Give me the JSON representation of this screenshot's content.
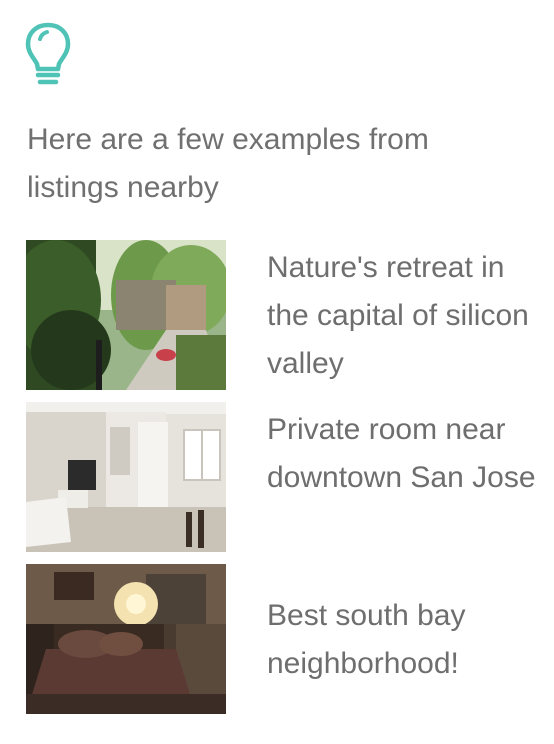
{
  "icon": {
    "name": "lightbulb-icon",
    "color": "#4fc3b5"
  },
  "intro_text": "Here are a few examples from listings nearby",
  "listings": [
    {
      "title": "Nature's retreat in the capital of silicon valley",
      "image": "garden-patio-photo"
    },
    {
      "title": "Private room near downtown San Jose",
      "image": "living-room-photo"
    },
    {
      "title": "Best south bay neighborhood!",
      "image": "bedroom-photo"
    }
  ]
}
